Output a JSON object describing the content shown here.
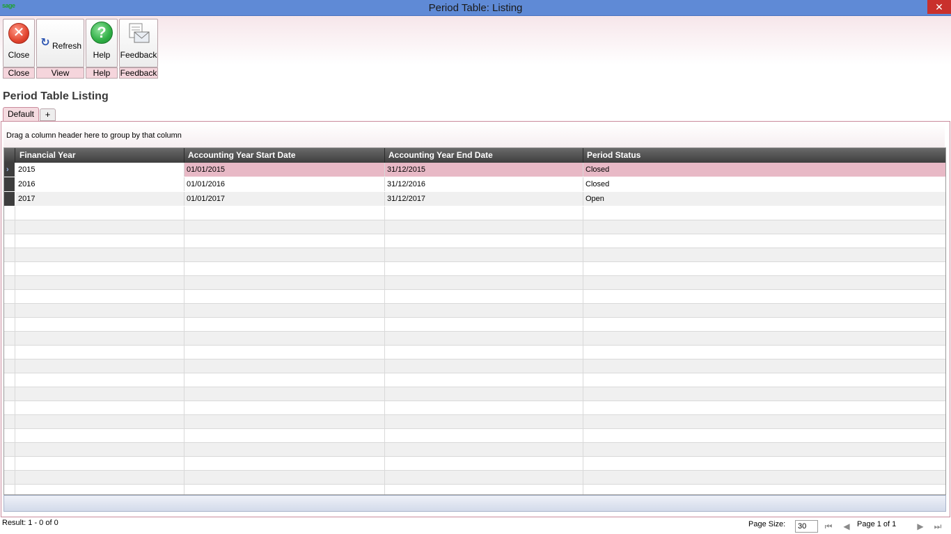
{
  "window": {
    "app_logo": "sage",
    "title": "Period Table: Listing",
    "close_glyph": "✕"
  },
  "ribbon": {
    "buttons": [
      {
        "label": "Close",
        "icon": "close-icon",
        "group": "Close"
      },
      {
        "label": "Refresh",
        "icon": "refresh-icon",
        "group": "View"
      },
      {
        "label": "Help",
        "icon": "help-icon",
        "group": "Help"
      },
      {
        "label": "Feedback",
        "icon": "feedback-icon",
        "group": "Feedback"
      }
    ]
  },
  "page": {
    "title": "Period Table Listing",
    "tabs": [
      {
        "label": "Default",
        "active": true
      }
    ],
    "add_tab_label": "+"
  },
  "grid": {
    "group_hint": "Drag a column header here to group by that column",
    "columns": [
      "Financial Year",
      "Accounting Year Start Date",
      "Accounting Year End Date",
      "Period Status"
    ],
    "rows": [
      {
        "financial_year": "2015",
        "start": "01/01/2015",
        "end": "31/12/2015",
        "status": "Closed",
        "selected": true
      },
      {
        "financial_year": "2016",
        "start": "01/01/2016",
        "end": "31/12/2016",
        "status": "Closed",
        "selected": false
      },
      {
        "financial_year": "2017",
        "start": "01/01/2017",
        "end": "31/12/2017",
        "status": "Open",
        "selected": false
      }
    ]
  },
  "status": {
    "result": "Result: 1 - 0 of 0",
    "page_size_label": "Page Size:",
    "page_size_value": "30",
    "page_info": "Page 1 of 1"
  },
  "colors": {
    "titlebar": "#5f8ad6",
    "selected_row": "#e8b9c6",
    "header": "#3e3e3e",
    "accent_border": "#c98a9b"
  }
}
